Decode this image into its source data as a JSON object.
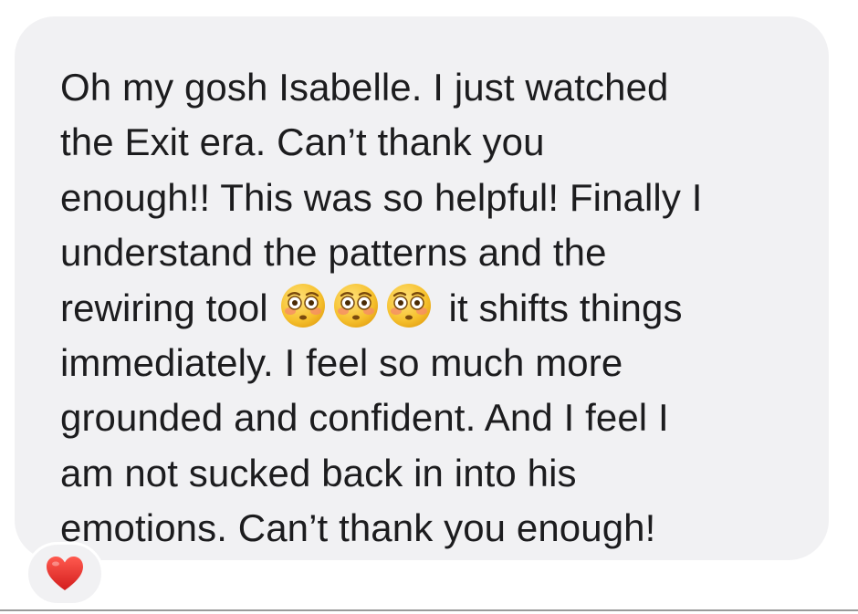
{
  "message": {
    "lines": {
      "l1": "Oh my gosh Isabelle. I just watched",
      "l2": "the Exit era. Can’t thank you",
      "l3": "enough!! This was so helpful! Finally I",
      "l4": "understand the patterns and the",
      "l5_before": "rewiring tool",
      "l5_after": "it shifts things",
      "l6": "immediately. I feel so much more",
      "l7": "grounded and confident. And I feel I",
      "l8": "am not sucked back in into his",
      "l9": "emotions. Can’t thank you enough!"
    },
    "emojis": [
      "flushed-face",
      "flushed-face",
      "flushed-face"
    ]
  },
  "reaction": {
    "icon": "red-heart-icon"
  },
  "colors": {
    "bubble": "#f1f1f3",
    "text": "#1c1c1e",
    "heart": "#e02a2a",
    "emoji_face": "#f8c431"
  }
}
